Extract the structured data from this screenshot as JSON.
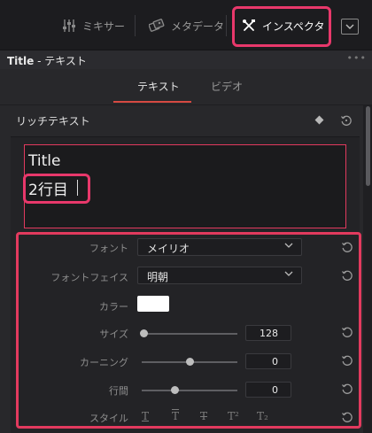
{
  "toolbar": {
    "mixer_label": "ミキサー",
    "metadata_label": "メタデータ",
    "inspector_label": "インスペクタ"
  },
  "panel": {
    "title_prefix": "Title",
    "title_suffix": " - テキスト",
    "more": "•••"
  },
  "tabs": [
    {
      "label": "テキスト",
      "active": true
    },
    {
      "label": "ビデオ",
      "active": false
    }
  ],
  "section": {
    "title": "リッチテキスト"
  },
  "textbox": {
    "line1": "Title",
    "line2": "2行目"
  },
  "properties": {
    "font_label": "フォント",
    "font_value": "メイリオ",
    "font_face_label": "フォントフェイス",
    "font_face_value": "明朝",
    "color_label": "カラー",
    "size_label": "サイズ",
    "size_value": "128",
    "kerning_label": "カーニング",
    "kerning_value": "0",
    "line_spacing_label": "行間",
    "line_spacing_value": "0",
    "style_label": "スタイル"
  },
  "style_icons": [
    "T",
    "T",
    "T",
    "T²",
    "T₂"
  ],
  "colors": {
    "highlight": "#e23a5e",
    "tab_underline": "#d64a42",
    "text_color_swatch": "#ffffff"
  }
}
